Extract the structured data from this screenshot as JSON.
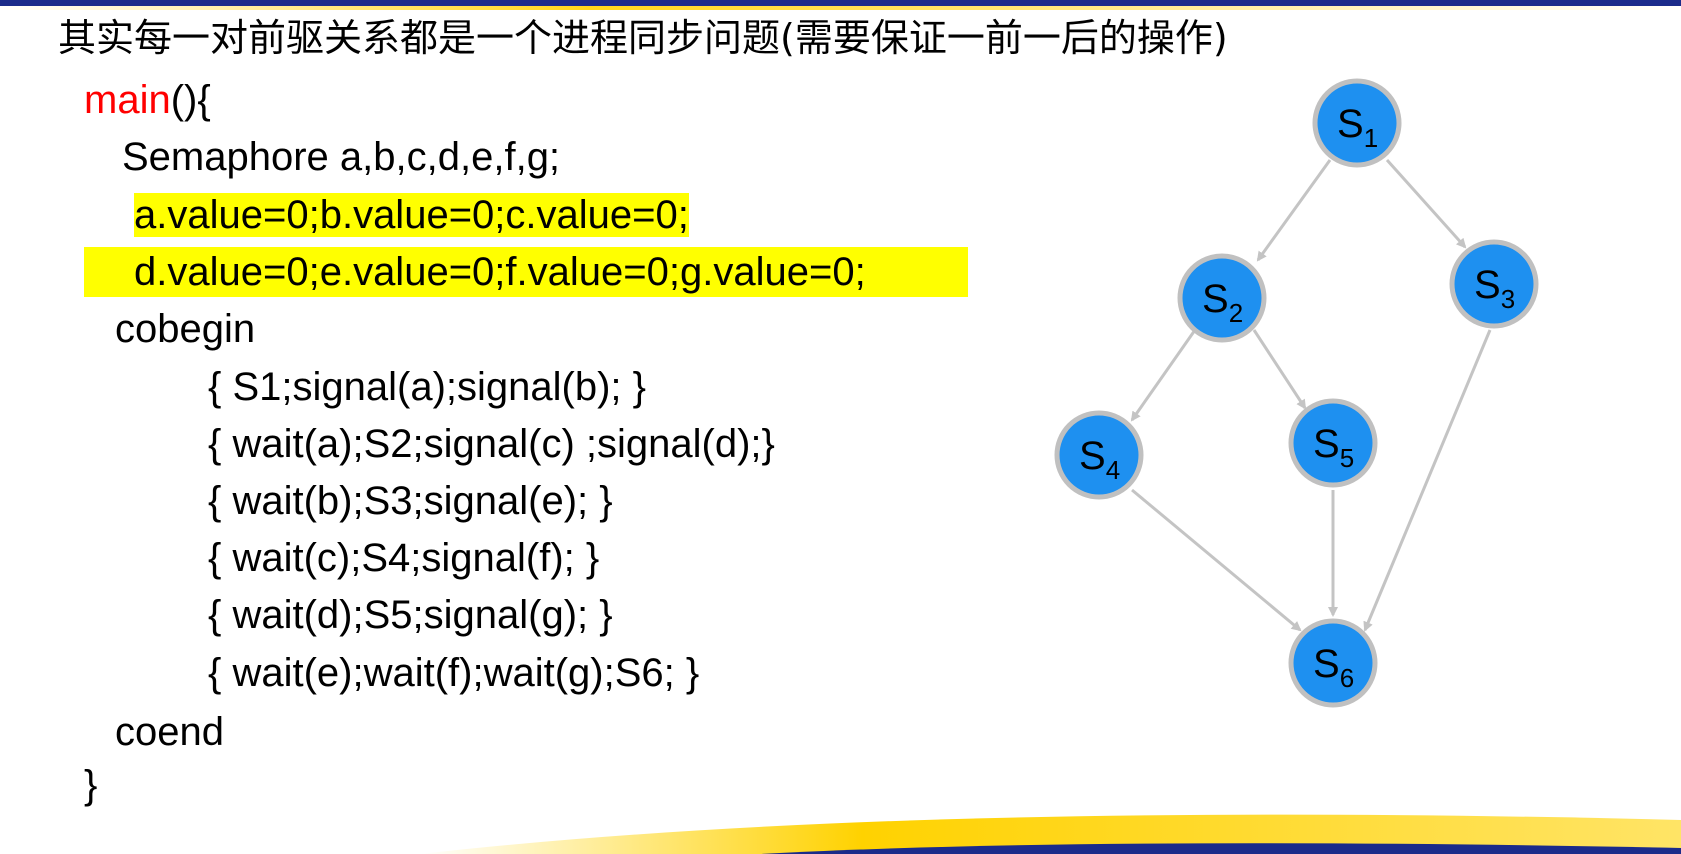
{
  "heading": "其实每一对前驱关系都是一个进程同步问题(需要保证一前一后的操作)",
  "code": {
    "main_keyword": "main",
    "main_rest": "(){",
    "declare": "Semaphore a,b,c,d,e,f,g;",
    "init_line1": "a.value=0;b.value=0;c.value=0;",
    "init_line2": "d.value=0;e.value=0;f.value=0;g.value=0;",
    "cobegin": "cobegin",
    "blocks": [
      "{ S1;signal(a);signal(b); }",
      "{ wait(a);S2;signal(c) ;signal(d);}",
      "{ wait(b);S3;signal(e); }",
      "{ wait(c);S4;signal(f); }",
      "{ wait(d);S5;signal(g); }",
      "{ wait(e);wait(f);wait(g);S6; }"
    ],
    "coend": "coend",
    "closing": "}"
  },
  "graph": {
    "nodes": [
      {
        "label": "S",
        "sub": "1"
      },
      {
        "label": "S",
        "sub": "2"
      },
      {
        "label": "S",
        "sub": "3"
      },
      {
        "label": "S",
        "sub": "4"
      },
      {
        "label": "S",
        "sub": "5"
      },
      {
        "label": "S",
        "sub": "6"
      }
    ],
    "edges": [
      [
        "S1",
        "S2"
      ],
      [
        "S1",
        "S3"
      ],
      [
        "S2",
        "S4"
      ],
      [
        "S2",
        "S5"
      ],
      [
        "S4",
        "S6"
      ],
      [
        "S5",
        "S6"
      ],
      [
        "S3",
        "S6"
      ]
    ],
    "colors": {
      "node_fill": "#1e90f0",
      "node_stroke": "#c0c0c0",
      "edge": "#c4c4c4",
      "highlight": "#ffff00",
      "keyword": "#ff0000"
    }
  }
}
